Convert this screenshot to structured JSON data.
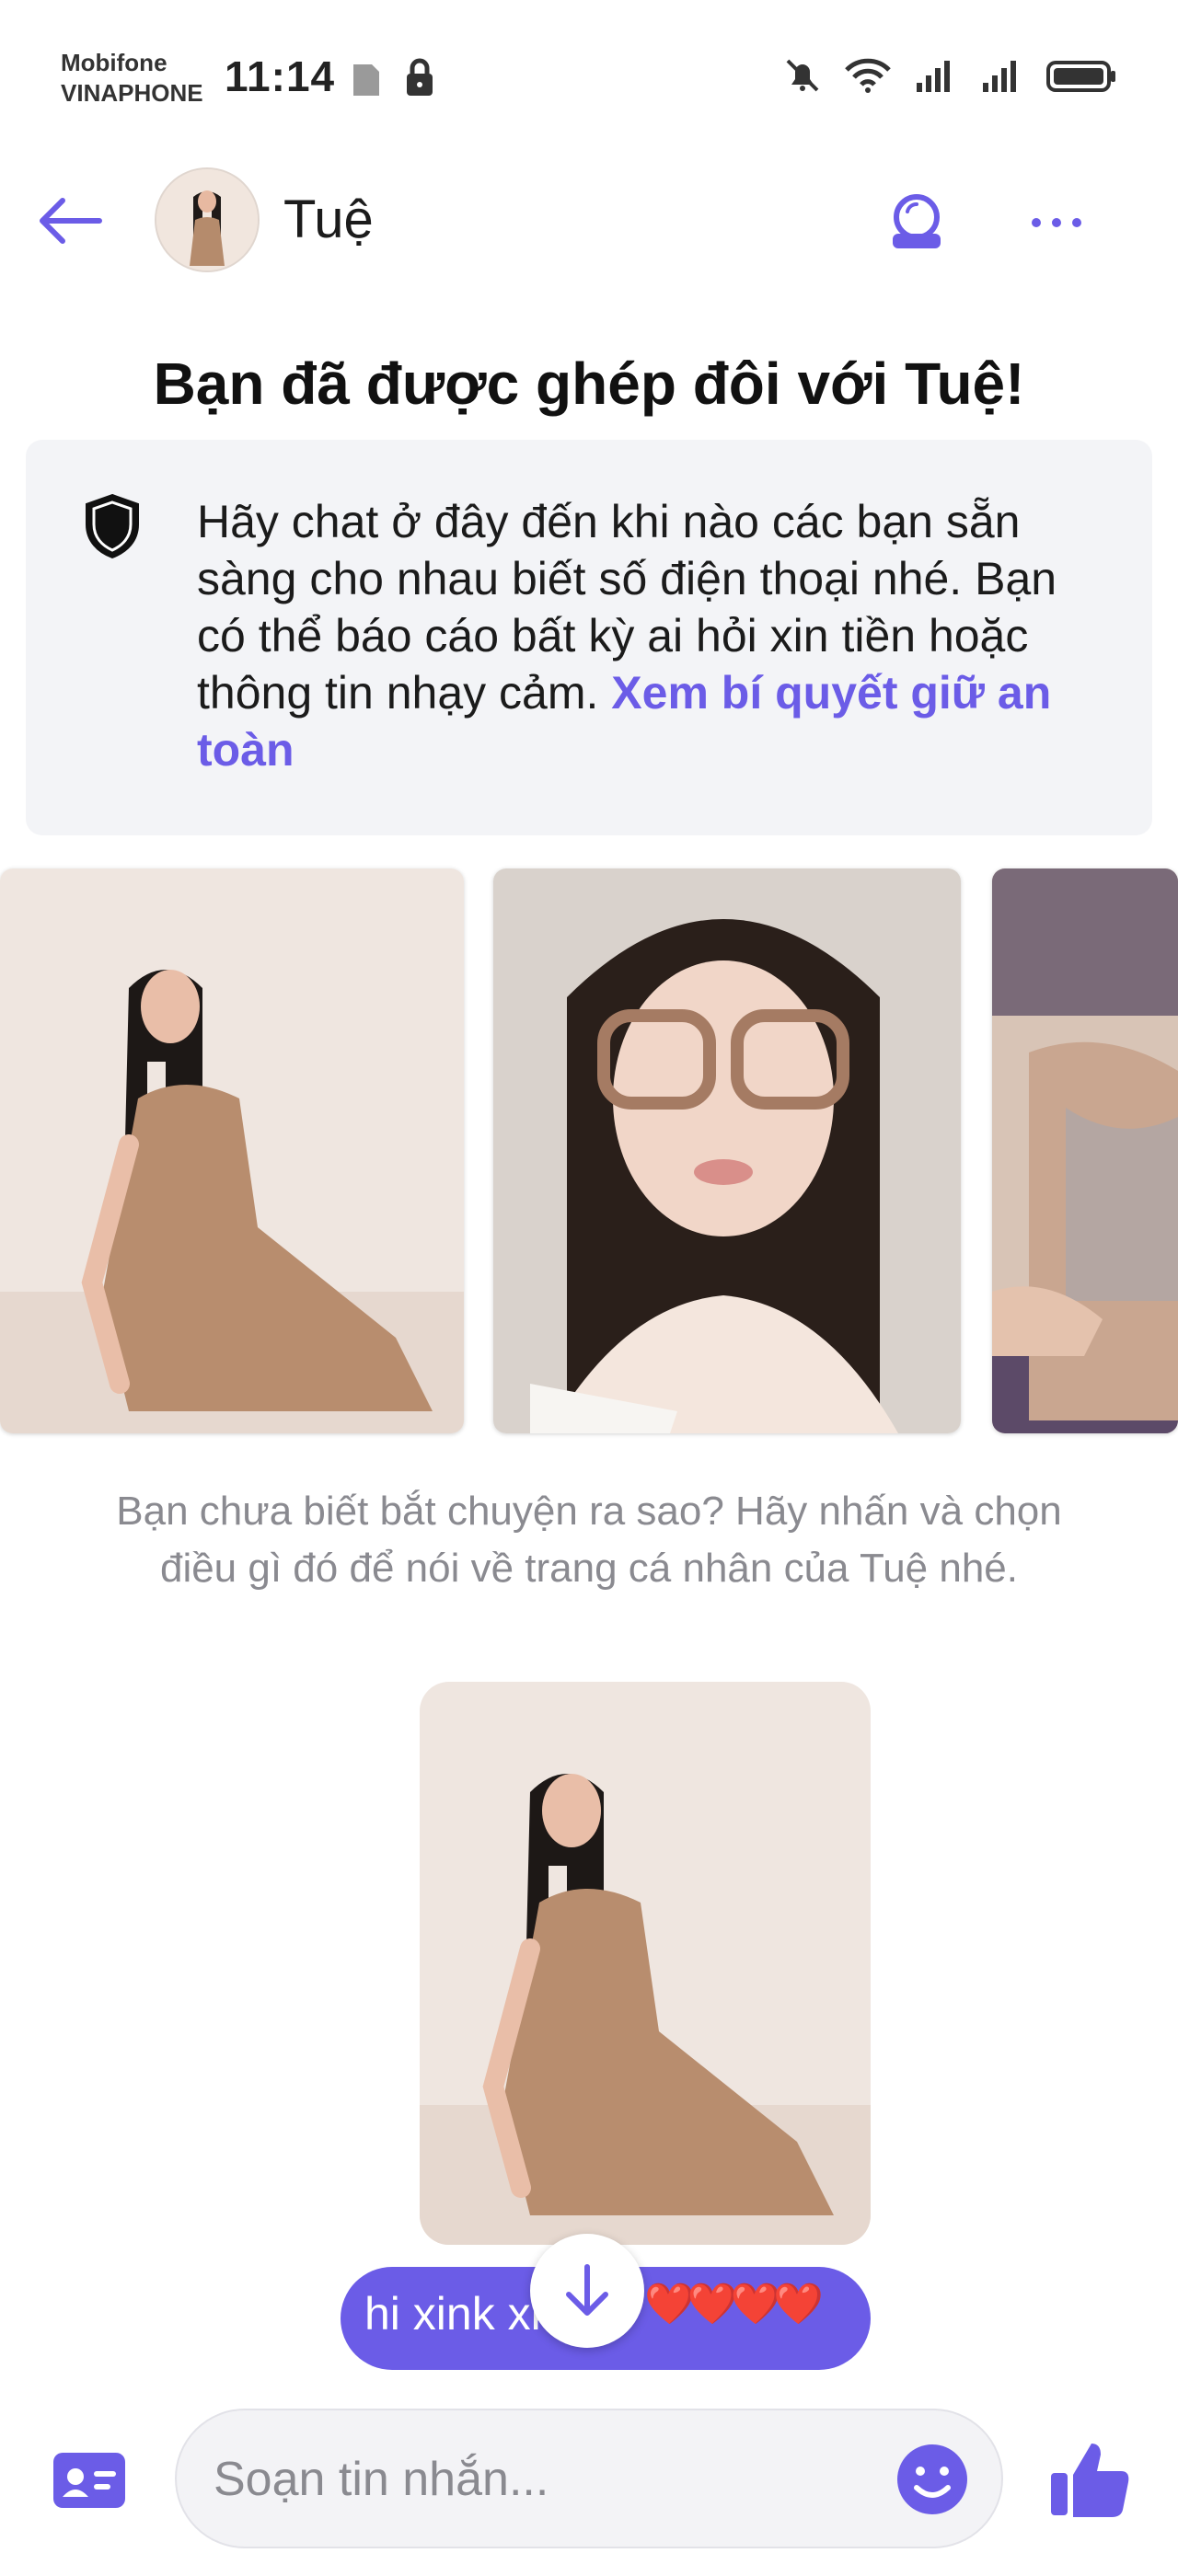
{
  "status_bar": {
    "carrier_1": "Mobifone",
    "carrier_2": "VINAPHONE",
    "time": "11:14",
    "icons": [
      "sim-icon",
      "lock-icon",
      "mute-bell-icon",
      "wifi-icon",
      "signal-icon",
      "signal-icon",
      "battery-icon"
    ]
  },
  "header": {
    "contact_name": "Tuệ",
    "icons": [
      "back-arrow-icon",
      "avatar",
      "date-mode-icon",
      "more-icon"
    ]
  },
  "match": {
    "title": "Bạn đã được ghép đôi với Tuệ!"
  },
  "safety": {
    "body": "Hãy chat ở đây đến khi nào các bạn sẵn sàng cho nhau biết số điện thoại nhé. Bạn có thể báo cáo bất kỳ ai hỏi xin tiền hoặc thông tin nhạy cảm. ",
    "link": "Xem bí quyết giữ an toàn",
    "icon": "shield-icon"
  },
  "photos": [
    "profile-photo-1",
    "profile-photo-2",
    "profile-photo-3"
  ],
  "hint": {
    "text": "Bạn chưa biết bắt chuyện ra sao? Hãy nhấn và chọn điều gì đó để nói về trang cá nhân của Tuệ nhé."
  },
  "message": {
    "text": "hi xink xk",
    "hearts": "❤️❤️❤️❤️"
  },
  "composer": {
    "placeholder": "Soạn tin nhắn..."
  },
  "colors": {
    "accent": "#6b5ce7",
    "card_bg": "#f3f4f7",
    "hint_text": "#8a8a90"
  }
}
